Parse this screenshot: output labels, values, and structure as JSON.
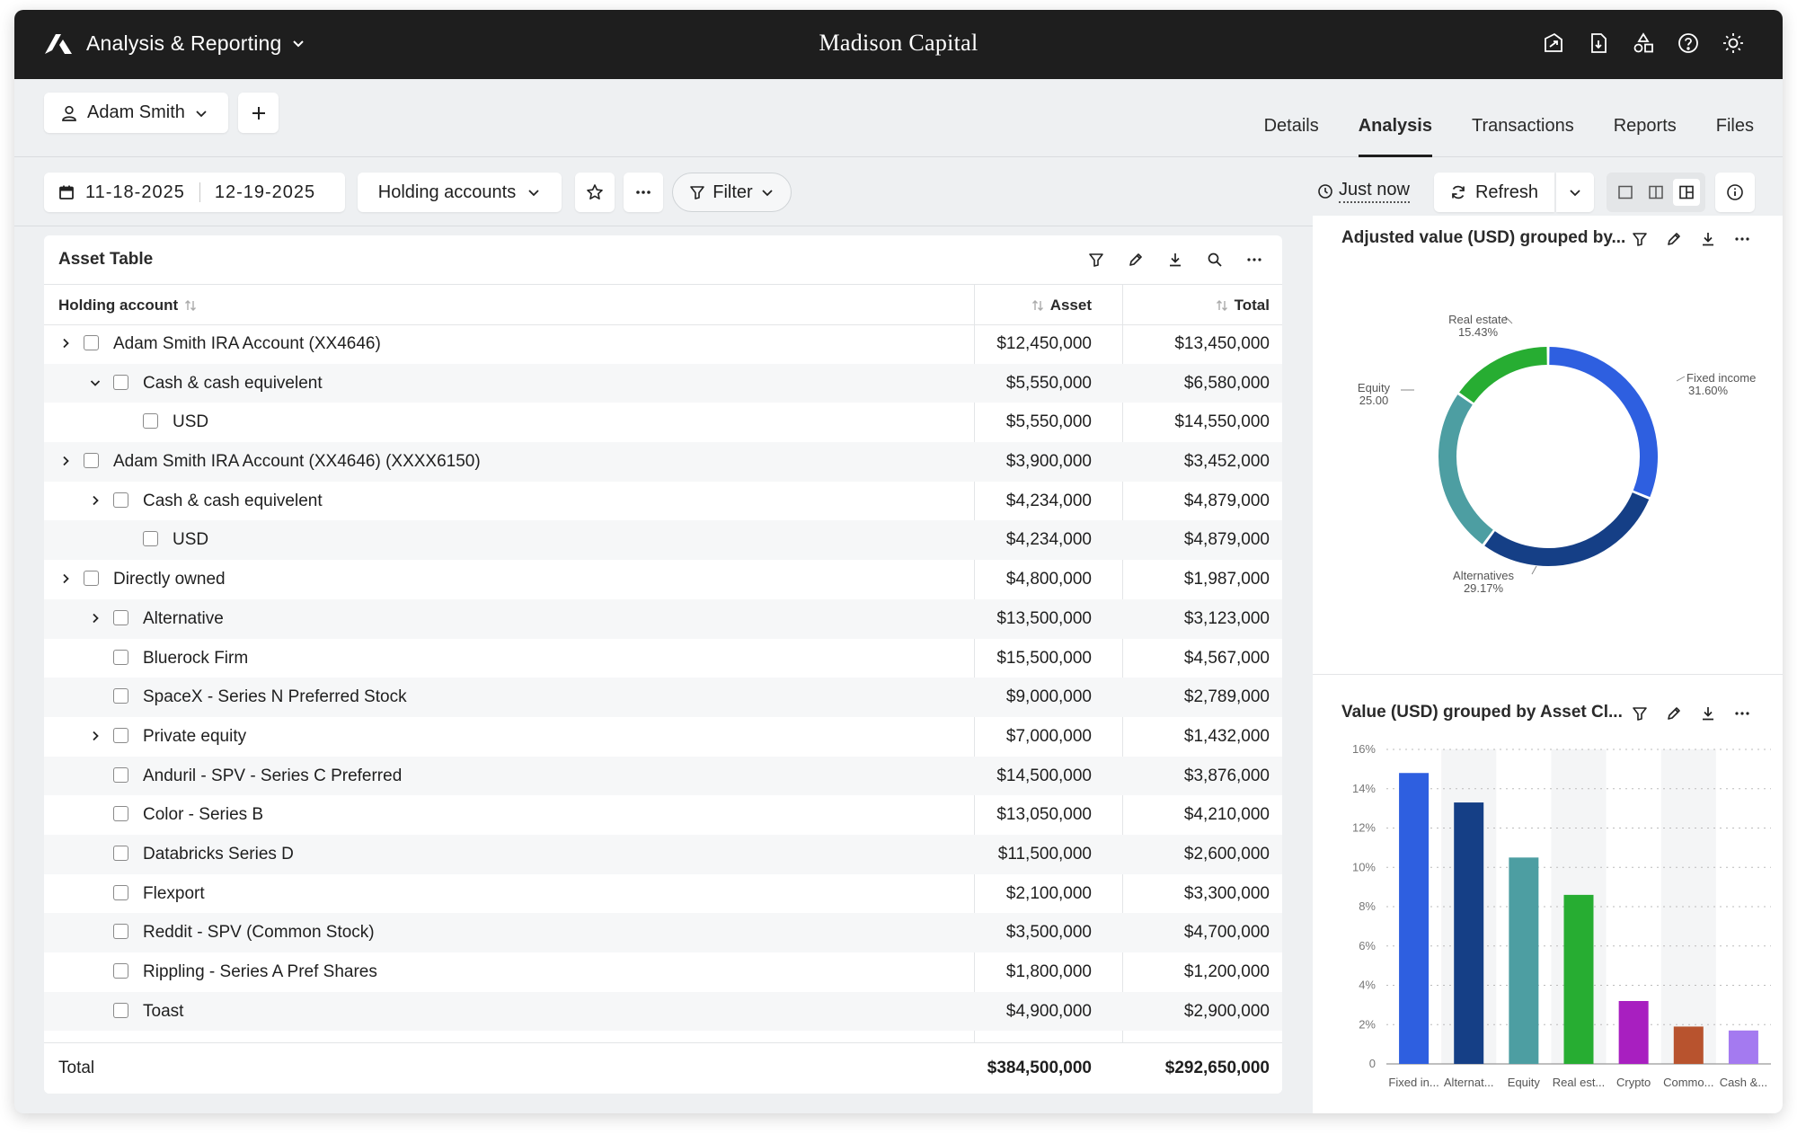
{
  "app": {
    "name": "Analysis & Reporting",
    "company": "Madison Capital",
    "top_icons": [
      "share-icon",
      "export-file-icon",
      "shapes-icon",
      "help-icon",
      "theme-sun-icon"
    ]
  },
  "user": {
    "name": "Adam Smith"
  },
  "tabs": [
    {
      "label": "Details",
      "active": false
    },
    {
      "label": "Analysis",
      "active": true
    },
    {
      "label": "Transactions",
      "active": false
    },
    {
      "label": "Reports",
      "active": false
    },
    {
      "label": "Files",
      "active": false
    }
  ],
  "toolbar": {
    "date_start": "11-18-2025",
    "date_end": "12-19-2025",
    "grouping": "Holding accounts",
    "filter_label": "Filter",
    "last_updated": "Just now",
    "refresh_label": "Refresh"
  },
  "asset_table": {
    "title": "Asset Table",
    "columns": {
      "name": "Holding account",
      "asset": "Asset",
      "total": "Total"
    },
    "rows": [
      {
        "level": 0,
        "caret": "right",
        "name": "Adam Smith IRA Account (XX4646)",
        "asset": "$12,450,000",
        "total": "$13,450,000"
      },
      {
        "level": 1,
        "caret": "down",
        "name": "Cash & cash equivelent",
        "asset": "$5,550,000",
        "total": "$6,580,000"
      },
      {
        "level": 2,
        "caret": "",
        "name": "USD",
        "asset": "$5,550,000",
        "total": "$14,550,000"
      },
      {
        "level": 0,
        "caret": "right",
        "name": "Adam Smith IRA Account (XX4646) (XXXX6150)",
        "asset": "$3,900,000",
        "total": "$3,452,000"
      },
      {
        "level": 1,
        "caret": "right",
        "name": "Cash & cash equivelent",
        "asset": "$4,234,000",
        "total": "$4,879,000"
      },
      {
        "level": 2,
        "caret": "",
        "name": "USD",
        "asset": "$4,234,000",
        "total": "$4,879,000"
      },
      {
        "level": 0,
        "caret": "right",
        "name": "Directly owned",
        "asset": "$4,800,000",
        "total": "$1,987,000"
      },
      {
        "level": 1,
        "caret": "right",
        "name": "Alternative",
        "asset": "$13,500,000",
        "total": "$3,123,000"
      },
      {
        "level": 1,
        "caret": "",
        "name": "Bluerock Firm",
        "asset": "$15,500,000",
        "total": "$4,567,000"
      },
      {
        "level": 1,
        "caret": "",
        "name": "SpaceX - Series N Preferred Stock",
        "asset": "$9,000,000",
        "total": "$2,789,000"
      },
      {
        "level": 1,
        "caret": "right",
        "name": "Private equity",
        "asset": "$7,000,000",
        "total": "$1,432,000"
      },
      {
        "level": 1,
        "caret": "",
        "name": "Anduril - SPV - Series C Preferred",
        "asset": "$14,500,000",
        "total": "$3,876,000"
      },
      {
        "level": 1,
        "caret": "",
        "name": "Color - Series B",
        "asset": "$13,050,000",
        "total": "$4,210,000"
      },
      {
        "level": 1,
        "caret": "",
        "name": "Databricks Series D",
        "asset": "$11,500,000",
        "total": "$2,600,000"
      },
      {
        "level": 1,
        "caret": "",
        "name": "Flexport",
        "asset": "$2,100,000",
        "total": "$3,300,000"
      },
      {
        "level": 1,
        "caret": "",
        "name": "Reddit - SPV (Common Stock)",
        "asset": "$3,500,000",
        "total": "$4,700,000"
      },
      {
        "level": 1,
        "caret": "",
        "name": "Rippling - Series A Pref Shares",
        "asset": "$1,800,000",
        "total": "$1,200,000"
      },
      {
        "level": 1,
        "caret": "",
        "name": "Toast",
        "asset": "$4,900,000",
        "total": "$2,900,000"
      }
    ],
    "total": {
      "label": "Total",
      "asset": "$384,500,000",
      "total": "$292,650,000"
    }
  },
  "chart_data": [
    {
      "type": "pie",
      "title": "Adjusted value (USD) grouped by...",
      "categories": [
        "Fixed income",
        "Alternatives",
        "Equity",
        "Real estate"
      ],
      "values": [
        31.6,
        29.17,
        25.0,
        15.43
      ],
      "value_labels": [
        "31.60%",
        "29.17%",
        "25.00",
        "15.43%"
      ],
      "colors": [
        "#2e5fe0",
        "#153f86",
        "#4d9ea2",
        "#27ad32"
      ],
      "style": "donut"
    },
    {
      "type": "bar",
      "title": "Value (USD) grouped by Asset Cl...",
      "categories": [
        "Fixed in...",
        "Alternat...",
        "Equity",
        "Real est...",
        "Crypto",
        "Commo...",
        "Cash &..."
      ],
      "values": [
        14.8,
        13.3,
        10.5,
        8.6,
        3.2,
        1.9,
        1.7
      ],
      "colors": [
        "#2e5fe0",
        "#153f86",
        "#4d9ea2",
        "#27ad32",
        "#a81fc0",
        "#b8532e",
        "#a47af0"
      ],
      "ylim": [
        0,
        16
      ],
      "yticks": [
        "0",
        "2%",
        "4%",
        "6%",
        "8%",
        "10%",
        "12%",
        "14%",
        "16%"
      ],
      "grid": true
    }
  ]
}
